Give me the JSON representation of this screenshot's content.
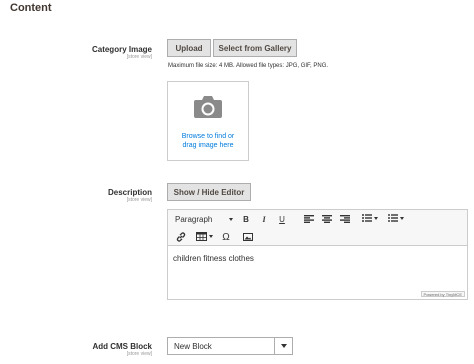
{
  "section": {
    "title": "Content"
  },
  "category_image": {
    "label": "Category Image",
    "scope": "[store view]",
    "upload_label": "Upload",
    "gallery_label": "Select from Gallery",
    "note": "Maximum file size: 4 MB. Allowed file types: JPG, GIF, PNG.",
    "dropzone_line1": "Browse to find or",
    "dropzone_line2": "drag image here"
  },
  "description": {
    "label": "Description",
    "scope": "[store view]",
    "toggle_label": "Show / Hide Editor",
    "format_select": "Paragraph",
    "content": "children fitness clothes",
    "powered_by": "Powered by TinyMCE"
  },
  "cms_block": {
    "label": "Add CMS Block",
    "scope": "[store view]",
    "selected": "New Block"
  }
}
